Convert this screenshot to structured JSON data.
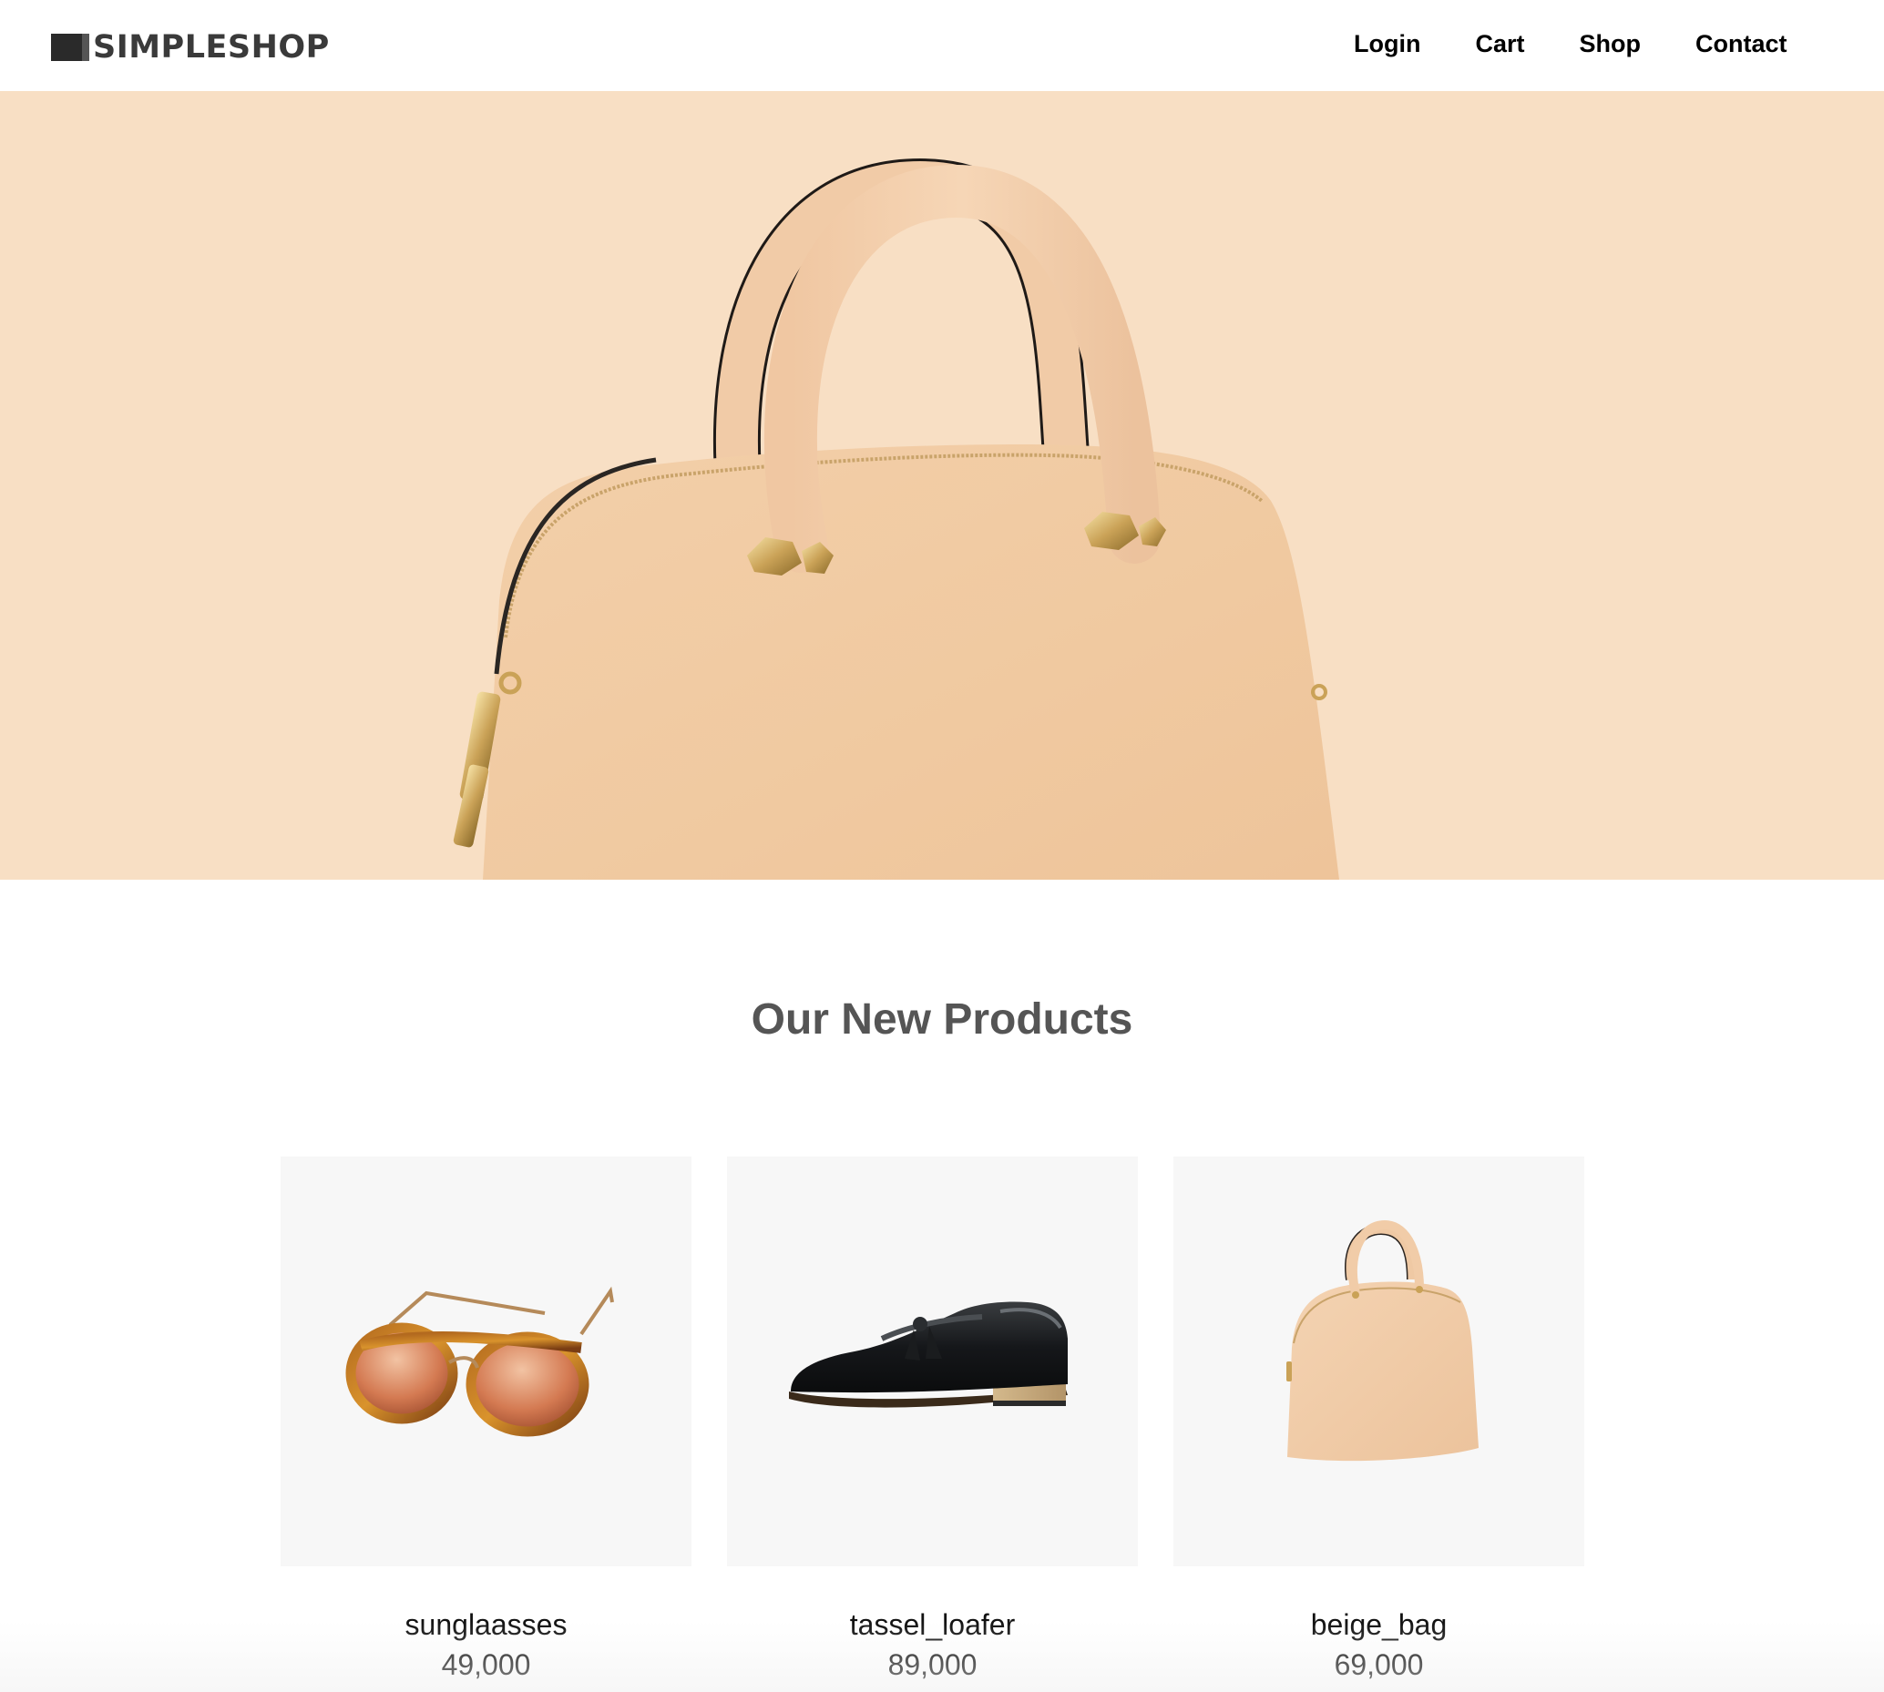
{
  "header": {
    "logo_text": "SIMPLESHOP",
    "nav": [
      {
        "label": "Login"
      },
      {
        "label": "Cart"
      },
      {
        "label": "Shop"
      },
      {
        "label": "Contact"
      }
    ]
  },
  "hero": {
    "image": "beige-handbag-banner",
    "background_color": "#f8dfc4"
  },
  "section": {
    "title": "Our New Products"
  },
  "products": [
    {
      "name": "sunglaasses",
      "price": "49,000",
      "image": "sunglasses-photo"
    },
    {
      "name": "tassel_loafer",
      "price": "89,000",
      "image": "loafer-shoe-photo"
    },
    {
      "name": "beige_bag",
      "price": "69,000",
      "image": "beige-handbag-photo"
    }
  ],
  "colors": {
    "hero_bg": "#f8dfc4",
    "card_bg": "#f7f7f7",
    "title_gray": "#555555",
    "logo_gray": "#3a3a3a"
  }
}
